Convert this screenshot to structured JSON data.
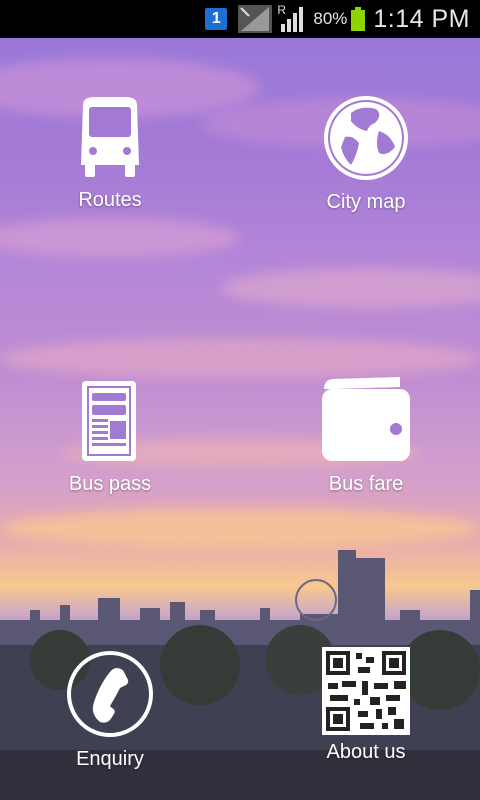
{
  "status_bar": {
    "sim_slot": "1",
    "roaming": "R",
    "battery": "80%",
    "time": "1:14 PM",
    "battery_color": "#8fd400",
    "sim_color": "#1c6fd3"
  },
  "menu": {
    "routes": {
      "label": "Routes",
      "icon": "bus-icon"
    },
    "city_map": {
      "label": "City map",
      "icon": "globe-icon"
    },
    "bus_pass": {
      "label": "Bus pass",
      "icon": "newspaper-icon"
    },
    "bus_fare": {
      "label": "Bus  fare",
      "icon": "wallet-icon"
    },
    "enquiry": {
      "label": "Enquiry",
      "icon": "phone-icon"
    },
    "about_us": {
      "label": "About us",
      "icon": "qr-code-icon"
    }
  }
}
